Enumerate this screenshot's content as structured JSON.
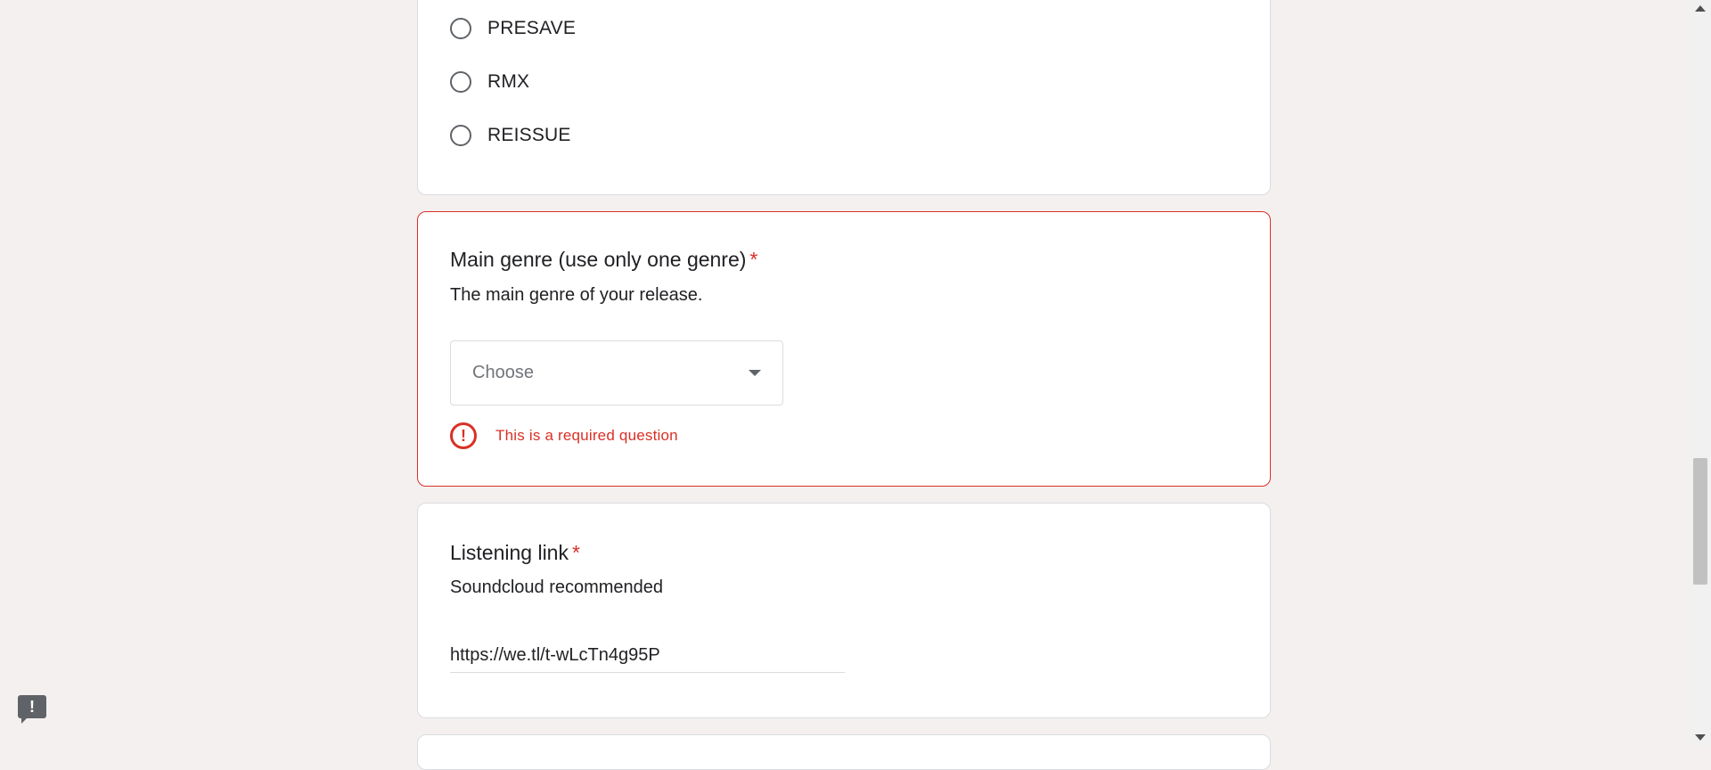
{
  "release_type": {
    "options": [
      {
        "label": "PRESAVE",
        "selected": false
      },
      {
        "label": "RMX",
        "selected": false
      },
      {
        "label": "REISSUE",
        "selected": false
      }
    ]
  },
  "main_genre": {
    "title": "Main genre (use only one genre)",
    "required_mark": "*",
    "description": "The main genre of your release.",
    "select_value": "Choose",
    "error": "This is a required question",
    "error_icon": "!"
  },
  "listening_link": {
    "title": "Listening link",
    "required_mark": "*",
    "description": "Soundcloud recommended",
    "value": "https://we.tl/t-wLcTn4g95P"
  },
  "feedback": {
    "icon": "!"
  },
  "colors": {
    "error": "#d93025",
    "background": "#f4f0ef"
  }
}
